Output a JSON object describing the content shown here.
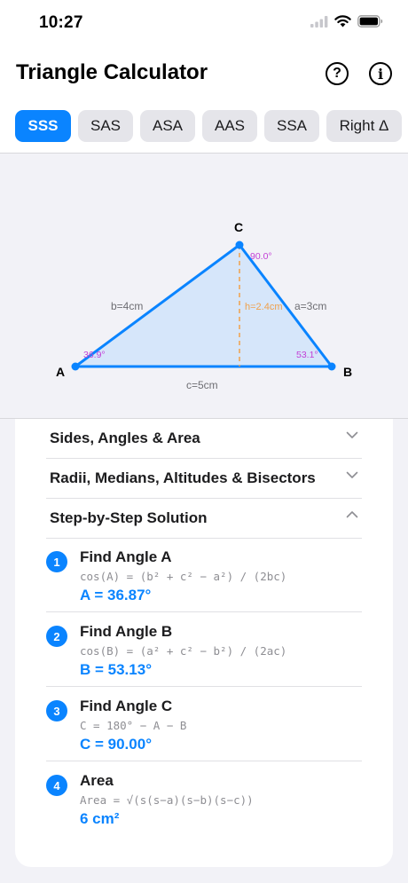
{
  "status_bar": {
    "time": "10:27"
  },
  "header": {
    "title": "Triangle Calculator",
    "help_icon": "question-circle-icon",
    "info_icon": "info-circle-icon"
  },
  "tabs": [
    {
      "label": "SSS",
      "active": true
    },
    {
      "label": "SAS",
      "active": false
    },
    {
      "label": "ASA",
      "active": false
    },
    {
      "label": "AAS",
      "active": false
    },
    {
      "label": "SSA",
      "active": false
    },
    {
      "label": "Right Δ",
      "active": false
    }
  ],
  "diagram": {
    "vertex_a": "A",
    "vertex_b": "B",
    "vertex_c": "C",
    "side_a": "a=3cm",
    "side_b": "b=4cm",
    "side_c": "c=5cm",
    "height": "h=2.4cm",
    "angle_a": "36.9°",
    "angle_b": "53.1°",
    "angle_c": "90.0°",
    "colors": {
      "outline": "#0a84ff",
      "fill": "#d6e6fa",
      "height": "#f0a04b",
      "angle": "#c23fd6",
      "side_label": "#6e6e73"
    }
  },
  "sections": [
    {
      "title": "Sides, Angles & Area",
      "expanded": false
    },
    {
      "title": "Radii, Medians, Altitudes & Bisectors",
      "expanded": false
    },
    {
      "title": "Step-by-Step Solution",
      "expanded": true
    }
  ],
  "steps": [
    {
      "number": "1",
      "title": "Find Angle A",
      "formula": "cos(A) = (b² + c² − a²) / (2bc)",
      "result": "A = 36.87°"
    },
    {
      "number": "2",
      "title": "Find Angle B",
      "formula": "cos(B) = (a² + c² − b²) / (2ac)",
      "result": "B = 53.13°"
    },
    {
      "number": "3",
      "title": "Find Angle C",
      "formula": "C = 180° − A − B",
      "result": "C = 90.00°"
    },
    {
      "number": "4",
      "title": "Area",
      "formula": "Area = √(s(s−a)(s−b)(s−c))",
      "result": "6 cm²"
    }
  ],
  "accent_color": "#0a84ff"
}
